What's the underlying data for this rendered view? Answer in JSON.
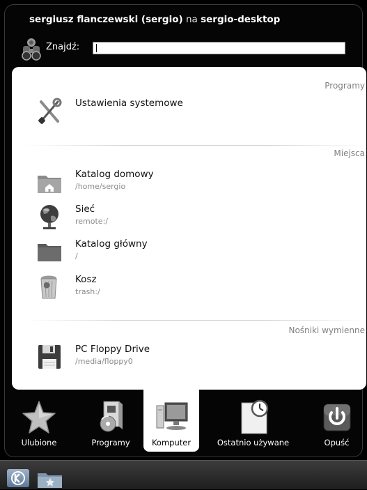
{
  "header": {
    "user_name": "sergiusz flanczewski (sergio)",
    "connector": "na",
    "host": "sergio-desktop"
  },
  "search": {
    "label": "Znajdź:",
    "value": ""
  },
  "sections": {
    "programs": {
      "label": "Programy",
      "items": [
        {
          "name": "Ustawienia systemowe",
          "sub": ""
        }
      ]
    },
    "places": {
      "label": "Miejsca",
      "items": [
        {
          "name": "Katalog domowy",
          "sub": "/home/sergio"
        },
        {
          "name": "Sieć",
          "sub": "remote:/"
        },
        {
          "name": "Katalog główny",
          "sub": "/"
        },
        {
          "name": "Kosz",
          "sub": "trash:/"
        }
      ]
    },
    "removable": {
      "label": "Nośniki wymienne",
      "items": [
        {
          "name": "PC Floppy Drive",
          "sub": "/media/floppy0"
        }
      ]
    }
  },
  "tabs": [
    {
      "label": "Ulubione"
    },
    {
      "label": "Programy"
    },
    {
      "label": "Komputer",
      "active": true
    },
    {
      "label": "Ostatnio używane"
    },
    {
      "label": "Opuść"
    }
  ]
}
